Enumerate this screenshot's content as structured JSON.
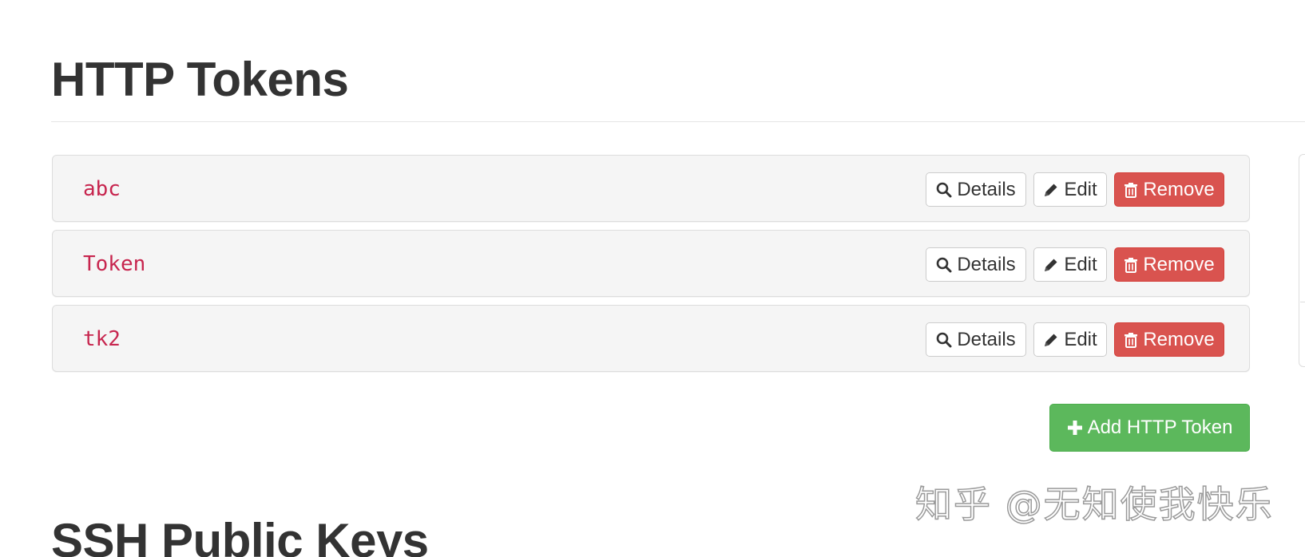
{
  "section": {
    "title": "HTTP Tokens"
  },
  "tokens": [
    {
      "name": "abc",
      "details_label": "Details",
      "edit_label": "Edit",
      "remove_label": "Remove"
    },
    {
      "name": "Token",
      "details_label": "Details",
      "edit_label": "Edit",
      "remove_label": "Remove"
    },
    {
      "name": "tk2",
      "details_label": "Details",
      "edit_label": "Edit",
      "remove_label": "Remove"
    }
  ],
  "add_button": {
    "label": "Add HTTP Token"
  },
  "next_section": {
    "title": "SSH Public Keys"
  },
  "watermark": {
    "text": "知乎 @无知使我快乐"
  },
  "icons": {
    "details": "search-icon",
    "edit": "pencil-icon",
    "remove": "trash-icon",
    "add": "plus-icon"
  },
  "colors": {
    "token_name": "#c7254e",
    "danger": "#d9534f",
    "success": "#5cb85c",
    "row_background": "#f5f5f5"
  }
}
